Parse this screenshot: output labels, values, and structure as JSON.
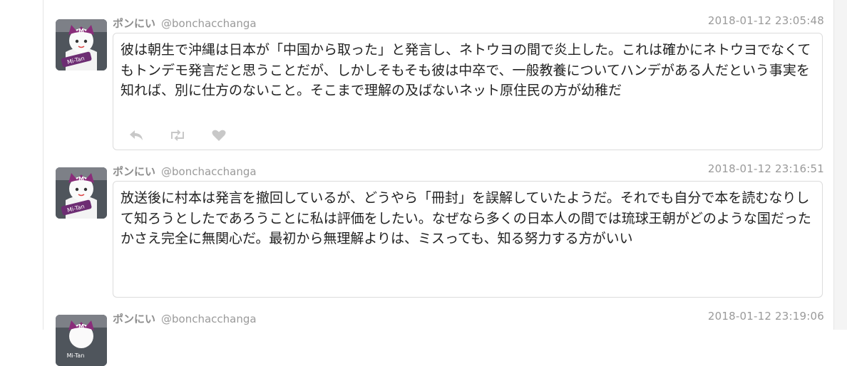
{
  "posts": [
    {
      "display_name": "ポンにい",
      "handle": "@bonchacchanga",
      "timestamp": "2018-01-12 23:05:48",
      "text": "彼は朝生で沖縄は日本が「中国から取った」と発言し、ネトウヨの間で炎上した。これは確かにネトウヨでなくてもトンデモ発言だと思うことだが、しかしそもそも彼は中卒で、一般教養についてハンデがある人だという事実を知れば、別に仕方のないこと。そこまで理解の及ばないネット原住民の方が幼稚だ",
      "avatar_text": "Mi-Tan"
    },
    {
      "display_name": "ポンにい",
      "handle": "@bonchacchanga",
      "timestamp": "2018-01-12 23:16:51",
      "text": "放送後に村本は発言を撤回しているが、どうやら「冊封」を誤解していたようだ。それでも自分で本を読むなりして知ろうとしたであろうことに私は評価をしたい。なぜなら多くの日本人の間では琉球王朝がどのような国だったかさえ完全に無関心だ。最初から無理解よりは、ミスっても、知る努力する方がいい",
      "avatar_text": "Mi-Tan"
    },
    {
      "display_name": "ポンにい",
      "handle": "@bonchacchanga",
      "timestamp": "2018-01-12 23:19:06",
      "avatar_text": "Mi-Tan"
    }
  ],
  "icons": {
    "reply": "reply-icon",
    "retweet": "retweet-icon",
    "like": "heart-icon"
  },
  "colors": {
    "name": "#8d8d8d",
    "meta": "#9a9a9a",
    "action": "#c8c8c8",
    "border": "#dcdcdc"
  }
}
